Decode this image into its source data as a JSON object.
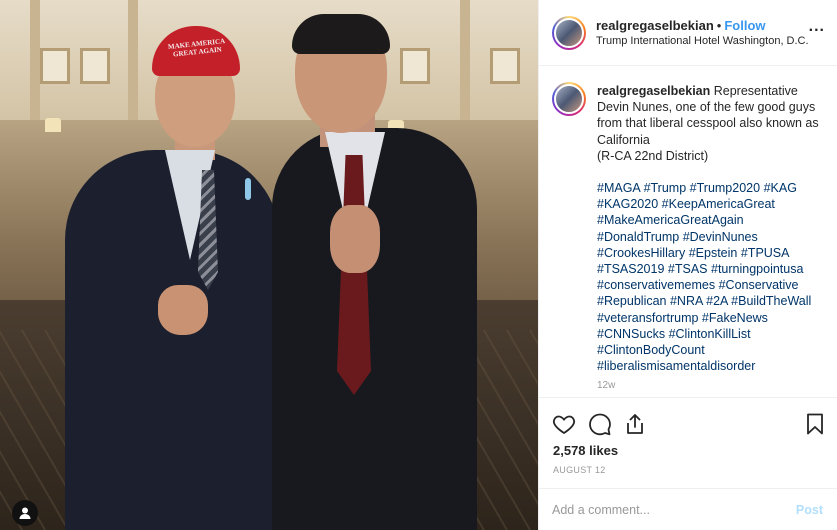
{
  "post": {
    "username": "realgregaselbekian",
    "follow_label": "Follow",
    "separator": "•",
    "location": "Trump International Hotel Washington, D.C.",
    "more_label": "...",
    "caption_text": "Representative Devin Nunes, one of the few good guys from that liberal cesspool also known as California",
    "district": "(R-CA 22nd District)",
    "hashtags": [
      "#MAGA",
      "#Trump",
      "#Trump2020",
      "#KAG",
      "#KAG2020",
      "#KeepAmericaGreat",
      "#MakeAmericaGreatAgain",
      "#DonaldTrump",
      "#DevinNunes",
      "#CrookesHillary",
      "#Epstein",
      "#TPUSA",
      "#TSAS2019",
      "#TSAS",
      "#turningpointusa",
      "#conservativememes",
      "#Conservative",
      "#Republican",
      "#NRA",
      "#2A",
      "#BuildTheWall",
      "#veteransfortrump",
      "#FakeNews",
      "#CNNSucks",
      "#ClintonKillList",
      "#ClintonBodyCount",
      "#liberalismisamentaldisorder"
    ],
    "time_ago": "12w",
    "likes": "2,578 likes",
    "date": "AUGUST 12",
    "comment_placeholder": "Add a comment...",
    "post_label": "Post"
  },
  "photo": {
    "hat_text": "MAKE AMERICA GREAT AGAIN"
  },
  "icons": {
    "like": "heart-icon",
    "comment": "comment-bubble-icon",
    "share": "share-icon",
    "save": "bookmark-icon",
    "user_tag": "user-tag-icon",
    "more": "more-options-icon"
  },
  "colors": {
    "link": "#3897f0",
    "hashtag": "#003569",
    "muted": "#999999",
    "post_disabled": "#b2dffc"
  }
}
